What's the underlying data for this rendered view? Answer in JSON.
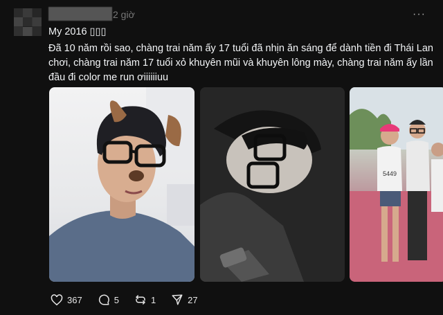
{
  "post": {
    "time": "2 giờ",
    "more_label": "···",
    "title": "My 2016 ▯▯▯",
    "body": "Đã 10 năm rồi sao, chàng trai năm ấy 17 tuổi đã nhịn ăn sáng để dành tiền đi Thái Lan chơi, chàng trai năm 17 tuổi xỏ khuyên mũi và khuyên lông mày, chàng trai năm ấy lần đầu đi color me run ơiiiiiiuu",
    "photos": [
      {
        "icon": "selfie-dog-filter-photo",
        "bib_text": ""
      },
      {
        "icon": "selfie-glasses-dark-photo",
        "bib_text": ""
      },
      {
        "icon": "color-run-group-photo",
        "bib_text": "5449"
      }
    ],
    "actions": {
      "likes": "367",
      "comments": "5",
      "reposts": "1",
      "shares": "27"
    }
  },
  "colors": {
    "background": "#101010",
    "text": "#f3f5f7",
    "muted": "#777777"
  }
}
